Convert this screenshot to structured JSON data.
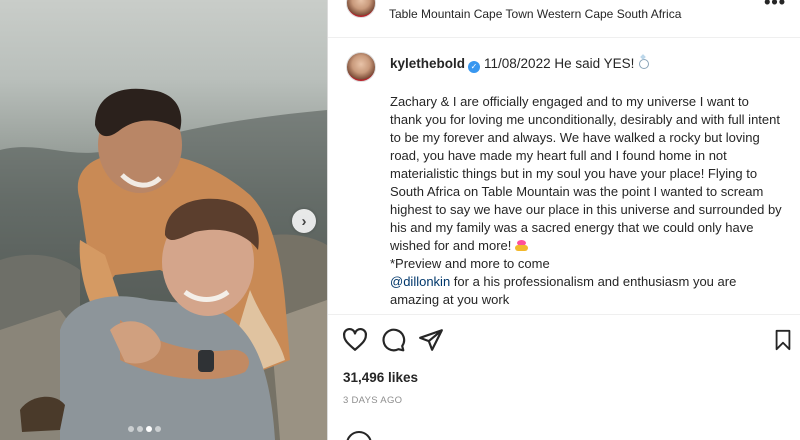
{
  "post": {
    "location": "Table Mountain Cape Town Western Cape South Africa",
    "more_icon": "ellipsis-icon",
    "carousel": {
      "slides": 4,
      "active_slide": 3,
      "next_icon": "chevron-right-icon"
    }
  },
  "caption": {
    "username": "kylethebold",
    "verified_icon": "verified-badge-icon",
    "headline": "11/08/2022 He said YES!",
    "headline_emoji": "ring-emoji",
    "paragraph": "Zachary & I are officially engaged and to my universe I want to thank you for loving me unconditionally, desirably and with full intent to be my forever and always. We have walked a rocky but loving road, you have made my heart full and I found home in not materialistic things but in my soul you have your place! Flying to South Africa on Table Mountain was the point I wanted to scream highest to say we have our place in this universe and surrounded by his and my family was a sacred energy that we could only have wished for and more!",
    "paragraph_emoji": "heart-hands-emoji",
    "preview_line": "*Preview and more to come",
    "mention": "@dillonkin",
    "mention_text": " for a his professionalism and enthusiasm you are amazing at you work"
  },
  "actions": {
    "like_icon": "heart-icon",
    "comment_icon": "comment-icon",
    "share_icon": "send-icon",
    "save_icon": "bookmark-icon"
  },
  "likes": "31,496 likes",
  "time_ago": "3 DAYS AGO",
  "colors": {
    "link": "#00376b",
    "verified": "#3897f0",
    "muted": "#8e8e8e",
    "text": "#262626"
  }
}
